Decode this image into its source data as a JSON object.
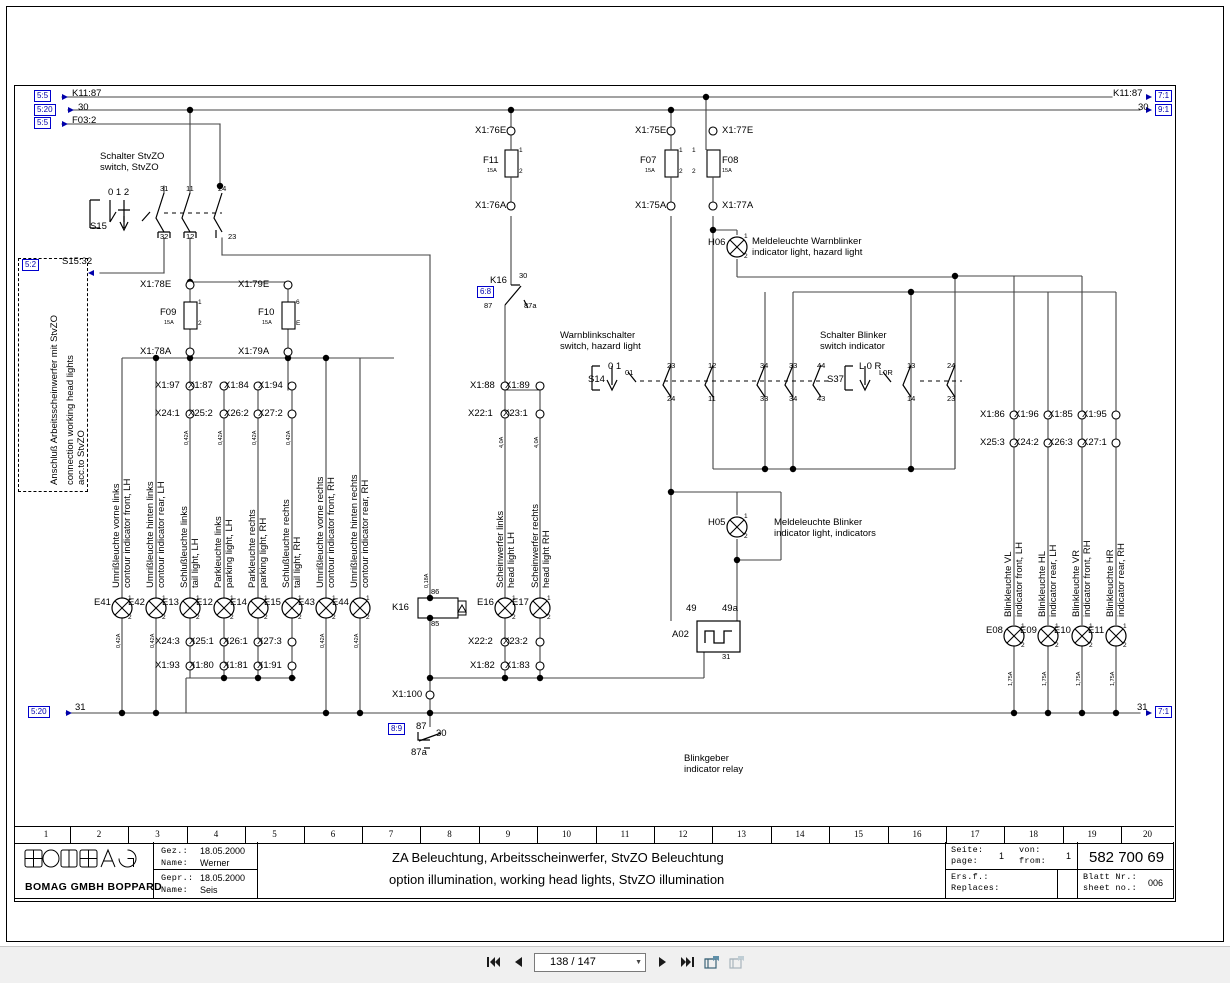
{
  "document": {
    "title_de": "ZA Beleuchtung, Arbeitsscheinwerfer, StvZO Beleuchtung",
    "title_en": "option illumination, working head lights, StvZO illumination",
    "drawing_number": "582 700 69",
    "sheet_no": "006",
    "page": "1",
    "from": "1"
  },
  "titleblock": {
    "company": "BOMAG",
    "company_sub": "BOMAG GMBH BOPPARD",
    "drawn_label": "Gez.:",
    "drawn_date": "18.05.2000",
    "drawn_name_label": "Name:",
    "drawn_name": "Werner",
    "checked_label": "Gepr.:",
    "checked_date": "18.05.2000",
    "checked_name_label": "Name:",
    "checked_name": "Seis",
    "page_label_de": "Seite:",
    "page_label_en": "page:",
    "from_label_de": "von:",
    "from_label_en": "from:",
    "replaces_label_de": "Ers.f.:",
    "replaces_label_en": "Replaces:",
    "sheet_label_de": "Blatt Nr.:",
    "sheet_label_en": "sheet no.:",
    "columns": [
      "1",
      "2",
      "3",
      "4",
      "5",
      "6",
      "7",
      "8",
      "9",
      "10",
      "11",
      "12",
      "13",
      "14",
      "15",
      "16",
      "17",
      "18",
      "19",
      "20"
    ]
  },
  "rails": {
    "top1_label": "K11:87",
    "top1_xref": "5:5",
    "top1_right_label": "K11:87",
    "top1_right_xref": "7:1",
    "top2_label": "30",
    "top2_xref": "5:20",
    "top2_right_label": "30",
    "top2_right_xref": "9:1",
    "top3_label": "F03:2",
    "top3_xref": "5:5",
    "bottom_label": "31",
    "bottom_xref": "5:20",
    "bottom_right_label": "31",
    "bottom_right_xref": "7:1"
  },
  "annotations": {
    "stvzo_box_line1": "Anschluß Arbeitsscheinwerfer mit StvZO",
    "stvzo_box_line2": "connection working head lights",
    "stvzo_box_line3": "acc.to StvZO",
    "stvzo_box_xref": "5:2",
    "stvzo_box_ref_label": "S15:32",
    "switch_stvzo_de": "Schalter StvZO",
    "switch_stvzo_en": "switch, StvZO",
    "hazard_switch_de": "Warnblinkschalter",
    "hazard_switch_en": "switch, hazard light",
    "indicator_switch_de": "Schalter Blinker",
    "indicator_switch_en": "switch indicator",
    "indicator_relay_de": "Blinkgeber",
    "indicator_relay_en": "indicator relay",
    "lamp_h06_de": "Meldeleuchte Warnblinker",
    "lamp_h06_en": "indicator light, hazard light",
    "lamp_h05_de": "Meldeleuchte Blinker",
    "lamp_h05_en": "indicator light, indicators"
  },
  "switches": {
    "s15": {
      "id": "S15",
      "positions": "0 1 2",
      "contacts_top": [
        "31",
        "11",
        "24"
      ],
      "contacts_bottom": [
        "32",
        "12",
        "23"
      ]
    },
    "s14": {
      "id": "S14",
      "positions": "0 1",
      "marker": "01",
      "contacts_top": [
        "23",
        "12",
        "34",
        "33",
        "44"
      ],
      "contacts_bottom": [
        "24",
        "11",
        "33",
        "34",
        "43"
      ]
    },
    "s37": {
      "id": "S37",
      "positions": "L 0 R",
      "marker": "L0R",
      "contacts_top": [
        "13",
        "24"
      ],
      "contacts_bottom": [
        "14",
        "23"
      ]
    }
  },
  "fuses": [
    {
      "id": "F09",
      "rating": "15A",
      "pin_top": "1",
      "pin_bottom": "2",
      "term_in": "X1:78E",
      "term_out": "X1:78A"
    },
    {
      "id": "F10",
      "rating": "15A",
      "pin_top": "6",
      "pin_bottom": "E",
      "term_in": "X1:79E",
      "term_out": "X1:79A"
    },
    {
      "id": "F11",
      "rating": "15A",
      "pin_top": "1",
      "pin_bottom": "2",
      "term_in": "X1:76E",
      "term_out": "X1:76A"
    },
    {
      "id": "F07",
      "rating": "15A",
      "pin_top": "1",
      "pin_bottom": "2",
      "term_in": "X1:75E",
      "term_out": "X1:75A"
    },
    {
      "id": "F08",
      "rating": "15A",
      "pin_top": "1",
      "pin_bottom": "2",
      "term_in": "X1:77E",
      "term_out": "X1:77A"
    }
  ],
  "relays": [
    {
      "id": "K16",
      "xref": "6:8",
      "pin_common": "30",
      "pin_nc": "87a",
      "pin_no": "87",
      "type": "contact"
    },
    {
      "id": "K16",
      "pin_top": "86",
      "pin_bottom": "85",
      "type": "coil",
      "gauge": "0,18A"
    },
    {
      "id": "A02",
      "pin_left": "49",
      "pin_right": "49a",
      "pin_bottom": "31",
      "type": "flasher"
    }
  ],
  "bottom_relay_ref": {
    "xref": "8:9",
    "pin_no": "87",
    "pin_common": "30",
    "pin_nc": "87a",
    "terminal": "X1:100"
  },
  "lamps_left": [
    {
      "id": "E41",
      "de": "Umrißleuchte vorne links",
      "en": "contour indicator front, LH",
      "pin_top": "1",
      "pin_bottom": "2",
      "gauge": "0,42A"
    },
    {
      "id": "E42",
      "de": "Umrißleuchte hinten links",
      "en": "contour indicator rear, LH",
      "pin_top": "1",
      "pin_bottom": "2",
      "gauge": "0,42A"
    },
    {
      "id": "E13",
      "de": "Schlußleuchte links",
      "en": "tail light, LH",
      "pin_top": "1",
      "pin_bottom": "2",
      "gauge": "0,42A",
      "term_top1": "X1:97",
      "term_top2": "X24:1",
      "term_bot1": "X24:3",
      "term_bot2": "X1:93"
    },
    {
      "id": "E12",
      "de": "Parkleuchte links",
      "en": "parking light, LH",
      "pin_top": "1",
      "pin_bottom": "2",
      "gauge": "0,42A",
      "term_top1": "X1:87",
      "term_top2": "X25:2",
      "term_bot1": "X25:1",
      "term_bot2": "X1:80"
    },
    {
      "id": "E14",
      "de": "Parkleuchte rechts",
      "en": "parking light, RH",
      "pin_top": "1",
      "pin_bottom": "2",
      "gauge": "0,42A",
      "term_top1": "X1:84",
      "term_top2": "X26:2",
      "term_bot1": "X26:1",
      "term_bot2": "X1:81"
    },
    {
      "id": "E15",
      "de": "Schlußleuchte rechts",
      "en": "tail light, RH",
      "pin_top": "1",
      "pin_bottom": "2",
      "gauge": "0,42A",
      "term_top1": "X1:94",
      "term_top2": "X27:2",
      "term_bot1": "X27:3",
      "term_bot2": "X1:91"
    },
    {
      "id": "E43",
      "de": "Umrißleuchte vorne rechts",
      "en": "contour indicator front, RH",
      "pin_top": "1",
      "pin_bottom": "2",
      "gauge": "0,42A"
    },
    {
      "id": "E44",
      "de": "Umrißleuchte hinten rechts",
      "en": "contour indicator rear, RH",
      "pin_top": "1",
      "pin_bottom": "2",
      "gauge": "0,42A"
    }
  ],
  "lamps_head": [
    {
      "id": "E16",
      "de": "Scheinwerfer links",
      "en": "head light LH",
      "pin_top": "1",
      "pin_bottom": "2",
      "gauge": "4,0A",
      "term_top1": "X1:88",
      "term_top2": "X22:1",
      "term_bot1": "X22:2",
      "term_bot2": "X1:82"
    },
    {
      "id": "E17",
      "de": "Scheinwerfer rechts",
      "en": "head light RH",
      "pin_top": "1",
      "pin_bottom": "2",
      "gauge": "4,0A",
      "term_top1": "X1:89",
      "term_top2": "X23:1",
      "term_bot1": "X23:2",
      "term_bot2": "X1:83"
    }
  ],
  "lamps_right": [
    {
      "id": "E08",
      "de": "Blinkleuchte VL",
      "en": "indicator front, LH",
      "pin_top": "1",
      "pin_bottom": "2",
      "gauge": "1,75A",
      "term_top1": "X1:86",
      "term_top2": "X25:3"
    },
    {
      "id": "E09",
      "de": "Blinkleuchte HL",
      "en": "indicator rear, LH",
      "pin_top": "1",
      "pin_bottom": "2",
      "gauge": "1,75A",
      "term_top1": "X1:96",
      "term_top2": "X24:2"
    },
    {
      "id": "E10",
      "de": "Blinkleuchte VR",
      "en": "indicator front, RH",
      "pin_top": "1",
      "pin_bottom": "2",
      "gauge": "1,75A",
      "term_top1": "X1:85",
      "term_top2": "X26:3"
    },
    {
      "id": "E11",
      "de": "Blinkleuchte HR",
      "en": "indicator rear, RH",
      "pin_top": "1",
      "pin_bottom": "2",
      "gauge": "1,75A",
      "term_top1": "X1:95",
      "term_top2": "X27:1"
    }
  ],
  "indicator_lamps": [
    {
      "id": "H06",
      "pin_top": "1",
      "pin_bottom": "2"
    },
    {
      "id": "H05",
      "pin_top": "1",
      "pin_bottom": "2"
    }
  ],
  "toolbar": {
    "first_page_icon": "first-page-icon",
    "prev_page_icon": "prev-page-icon",
    "page_value": "138 / 147",
    "next_page_icon": "next-page-icon",
    "last_page_icon": "last-page-icon",
    "open_icon": "open-window-icon",
    "copy_icon": "copy-window-icon"
  }
}
